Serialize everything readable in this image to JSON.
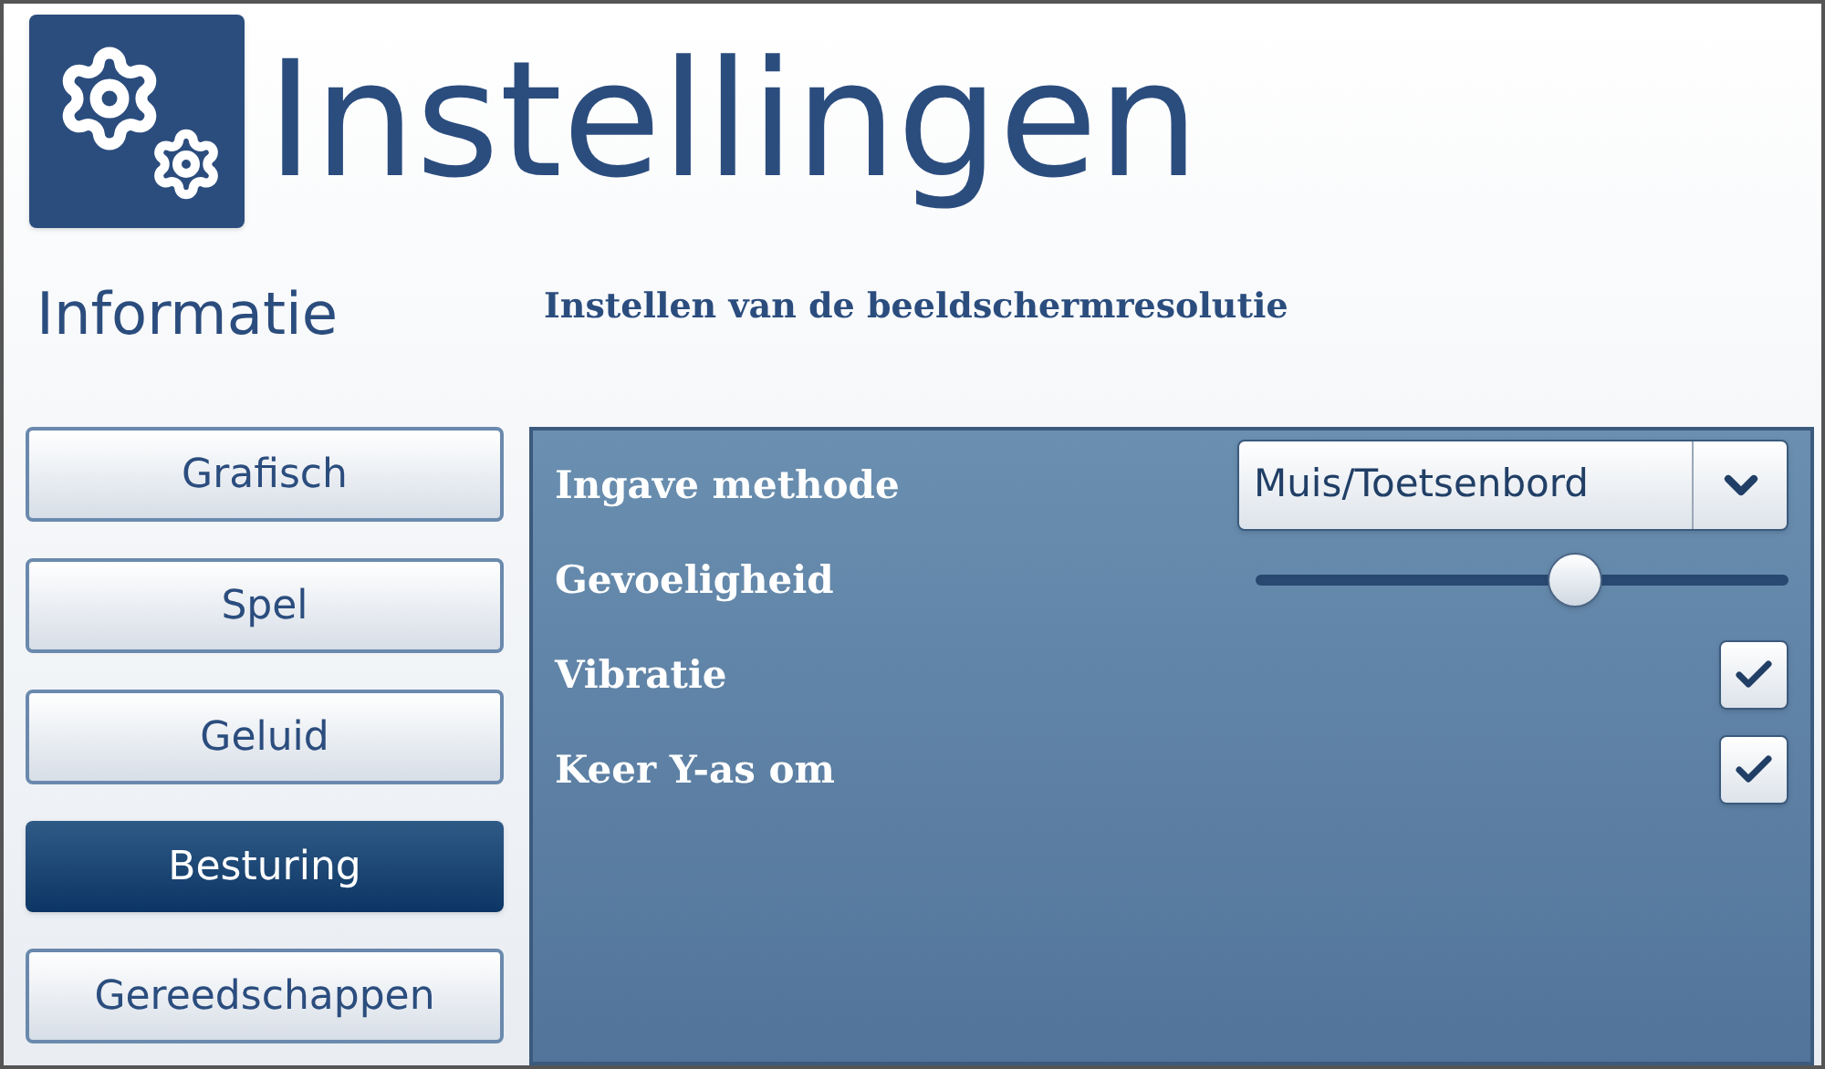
{
  "header": {
    "title": "Instellingen"
  },
  "sidebar": {
    "title": "Informatie",
    "items": [
      {
        "label": "Grafisch",
        "selected": false
      },
      {
        "label": "Spel",
        "selected": false
      },
      {
        "label": "Geluid",
        "selected": false
      },
      {
        "label": "Besturing",
        "selected": true
      },
      {
        "label": "Gereedschappen",
        "selected": false
      }
    ]
  },
  "content": {
    "subtitle": "Instellen van de beeldschermresolutie",
    "settings": [
      {
        "kind": "select",
        "label": "Ingave methode",
        "value": "Muis/Toetsenbord"
      },
      {
        "kind": "slider",
        "label": "Gevoeligheid",
        "level": 0.6
      },
      {
        "kind": "checkbox",
        "label": "Vibratie",
        "checked": true
      },
      {
        "kind": "checkbox",
        "label": "Keer Y-as om",
        "checked": true
      }
    ]
  }
}
